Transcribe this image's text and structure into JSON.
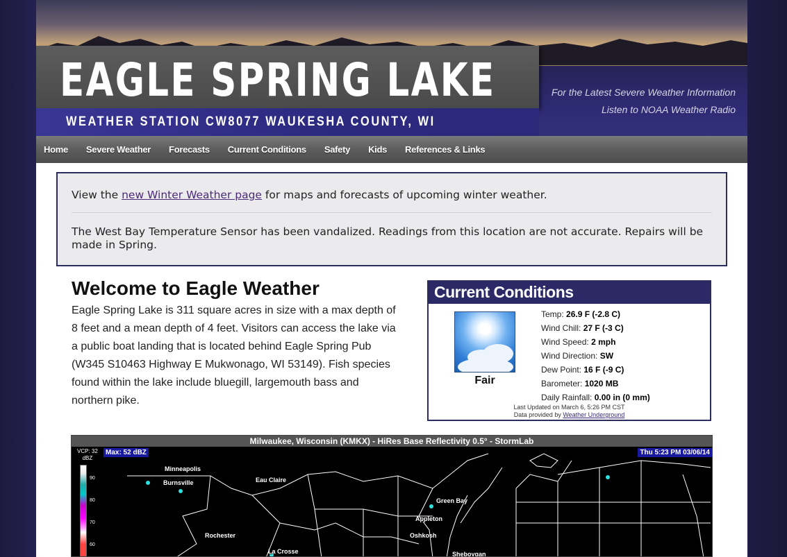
{
  "header": {
    "title": "EAGLE SPRING LAKE",
    "subtitle": "WEATHER STATION CW8077  WAUKESHA COUNTY, WI",
    "noaa_line1": "For the Latest Severe Weather Information",
    "noaa_line2": "Listen to NOAA Weather Radio"
  },
  "nav": {
    "items": [
      "Home",
      "Severe Weather",
      "Forecasts",
      "Current Conditions",
      "Safety",
      "Kids",
      "References & Links"
    ]
  },
  "notice": {
    "line1_prefix": "View the ",
    "line1_link": "new Winter Weather page",
    "line1_suffix": " for maps and forecasts of upcoming winter weather.",
    "line2": "The West Bay Temperature Sensor has been vandalized. Readings from this location are not accurate. Repairs will be made in Spring."
  },
  "welcome": {
    "title": "Welcome to Eagle Weather",
    "text": "Eagle Spring Lake is 311 square acres in size with a max depth of 8 feet and a mean depth of 4 feet. Visitors can access the lake via a public boat landing that is located behind Eagle Spring Pub (W345 S10463 Highway E Mukwonago, WI 53149). Fish species found within the lake include bluegill, largemouth bass and northern pike."
  },
  "current_conditions": {
    "heading": "Current Conditions",
    "condition": "Fair",
    "rows": [
      {
        "label": "Temp:",
        "value": "26.9 F (-2.8 C)"
      },
      {
        "label": "Wind Chill:",
        "value": "27 F (-3 C)"
      },
      {
        "label": "Wind Speed:",
        "value": "2 mph"
      },
      {
        "label": "Wind Direction:",
        "value": "SW"
      },
      {
        "label": "Dew Point:",
        "value": "16 F (-9 C)"
      },
      {
        "label": "Barometer:",
        "value": "1020 MB"
      },
      {
        "label": "Daily Rainfall:",
        "value": "0.00 in (0 mm)"
      }
    ],
    "updated": "Last Updated on March 6, 5:26 PM CST",
    "provided_prefix": "Data provided by ",
    "provided_link": "Weather Underground"
  },
  "radar": {
    "title": "Milwaukee, Wisconsin (KMKX) - HiRes Base Reflectivity 0.5° - StormLab",
    "max": "Max: 52 dBZ",
    "time": "Thu 5:23 PM 03/06/14",
    "vcp": "VCP: 32",
    "unit": "dBZ",
    "scale_ticks": [
      "90",
      "80",
      "70",
      "60"
    ],
    "cities": [
      "Minneapolis",
      "Burnsville",
      "Eau Claire",
      "Green Bay",
      "Appleton",
      "Rochester",
      "Oshkosh",
      "La Crosse",
      "Sheboygan"
    ]
  },
  "colors": {
    "accent": "#2b2a66",
    "link": "#4b2a78"
  }
}
